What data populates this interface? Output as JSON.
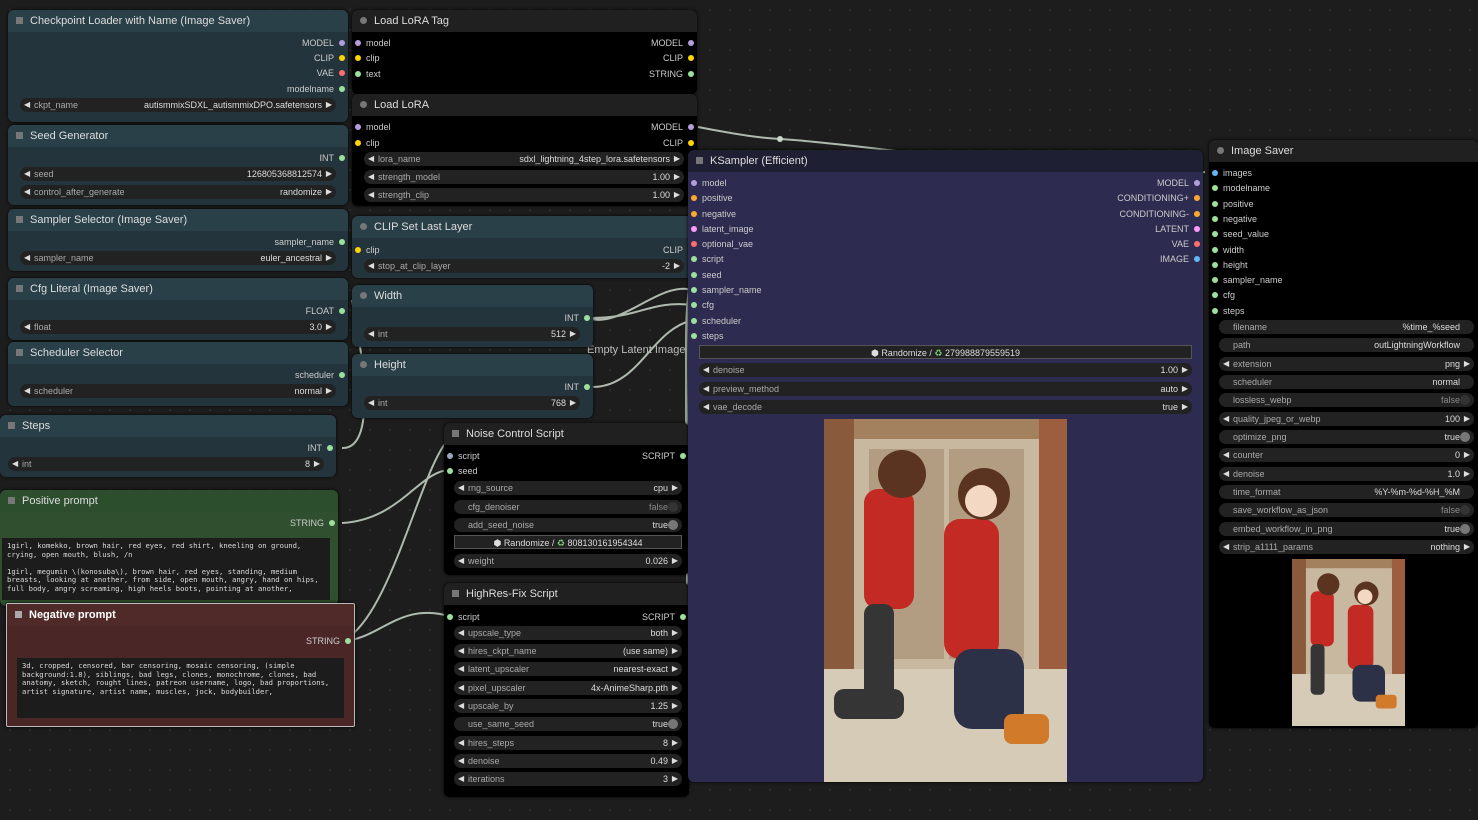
{
  "colors": {
    "model": "#b39ddb",
    "clip": "#ffd500",
    "vae": "#ff6e6e",
    "string": "#9de09d",
    "int": "#9de09d",
    "float": "#9de09d",
    "conditioning": "#ffa931",
    "latent": "#ff9cf9",
    "image": "#64b5f6",
    "script": "#9fa6bf"
  },
  "ckpt_loader": {
    "title": "Checkpoint Loader with Name (Image Saver)",
    "outputs": [
      "MODEL",
      "CLIP",
      "VAE",
      "modelname"
    ],
    "ckpt_label": "ckpt_name",
    "ckpt_value": "autismmixSDXL_autismmixDPO.safetensors"
  },
  "seed_gen": {
    "title": "Seed Generator",
    "output": "INT",
    "seed_label": "seed",
    "seed_value": "126805368812574",
    "cag_label": "control_after_generate",
    "cag_value": "randomize"
  },
  "sampler_sel": {
    "title": "Sampler Selector (Image Saver)",
    "output": "sampler_name",
    "label": "sampler_name",
    "value": "euler_ancestral"
  },
  "cfg_literal": {
    "title": "Cfg Literal (Image Saver)",
    "output": "FLOAT",
    "label": "float",
    "value": "3.0"
  },
  "sched_sel": {
    "title": "Scheduler Selector",
    "output": "scheduler",
    "label": "scheduler",
    "value": "normal"
  },
  "steps": {
    "title": "Steps",
    "output": "INT",
    "label": "int",
    "value": "8"
  },
  "pos_prompt": {
    "title": "Positive prompt",
    "output": "STRING",
    "text": "1girl, komekko, brown hair, red eyes, red shirt, kneeling on ground, crying, open mouth, blush, /n\n\n1girl, megumin \\(konosuba\\), brown hair, red eyes, standing, medium breasts, looking at another, from side, open mouth, angry, hand on hips, full body, angry screaming, high heels boots, pointing at another,"
  },
  "neg_prompt": {
    "title": "Negative prompt",
    "output": "STRING",
    "text": "3d, cropped, censored, bar censoring, mosaic censoring, (simple background:1.8), siblings, bad legs, clones, monochrome, clones, bad anatomy, sketch, rought lines, patreon username, logo, bad proportions, artist signature, artist name, muscles, jock, bodybuilder,"
  },
  "lora_tag": {
    "title": "Load LoRA Tag",
    "inputs": [
      "model",
      "clip",
      "text"
    ],
    "outputs": [
      "MODEL",
      "CLIP",
      "STRING"
    ]
  },
  "load_lora": {
    "title": "Load LoRA",
    "inputs": [
      "model",
      "clip"
    ],
    "outputs": [
      "MODEL",
      "CLIP"
    ],
    "w1_label": "lora_name",
    "w1_value": "sdxl_lightning_4step_lora.safetensors",
    "w2_label": "strength_model",
    "w2_value": "1.00",
    "w3_label": "strength_clip",
    "w3_value": "1.00"
  },
  "clip_last": {
    "title": "CLIP Set Last Layer",
    "input": "clip",
    "output": "CLIP",
    "label": "stop_at_clip_layer",
    "value": "-2"
  },
  "width": {
    "title": "Width",
    "output": "INT",
    "label": "int",
    "value": "512"
  },
  "height": {
    "title": "Height",
    "output": "INT",
    "label": "int",
    "value": "768"
  },
  "empty_latent": {
    "label": "Empty Latent Image"
  },
  "noise": {
    "title": "Noise Control Script",
    "inputs": [
      "script",
      "seed"
    ],
    "output": "SCRIPT",
    "rng_label": "rng_source",
    "rng_value": "cpu",
    "cfgd_label": "cfg_denoiser",
    "cfgd_value": "false",
    "asn_label": "add_seed_noise",
    "asn_value": "true",
    "rand_label": "Randomize /",
    "rand_seed": "808130161954344",
    "weight_label": "weight",
    "weight_value": "0.026"
  },
  "hires": {
    "title": "HighRes-Fix Script",
    "input": "script",
    "output": "SCRIPT",
    "rows": [
      {
        "label": "upscale_type",
        "value": "both"
      },
      {
        "label": "hires_ckpt_name",
        "value": "(use same)"
      },
      {
        "label": "latent_upscaler",
        "value": "nearest-exact"
      },
      {
        "label": "pixel_upscaler",
        "value": "4x-AnimeSharp.pth"
      },
      {
        "label": "upscale_by",
        "value": "1.25"
      },
      {
        "label": "use_same_seed",
        "value": "true"
      },
      {
        "label": "hires_steps",
        "value": "8"
      },
      {
        "label": "denoise",
        "value": "0.49"
      },
      {
        "label": "iterations",
        "value": "3"
      }
    ]
  },
  "ksampler": {
    "title": "KSampler (Efficient)",
    "inputs": [
      "model",
      "positive",
      "negative",
      "latent_image",
      "optional_vae",
      "script",
      "seed",
      "sampler_name",
      "cfg",
      "scheduler",
      "steps"
    ],
    "outputs": [
      "MODEL",
      "CONDITIONING+",
      "CONDITIONING-",
      "LATENT",
      "VAE",
      "IMAGE"
    ],
    "rand_label": "Randomize /",
    "rand_seed": "279988879559519",
    "rows": [
      {
        "label": "denoise",
        "value": "1.00"
      },
      {
        "label": "preview_method",
        "value": "auto"
      },
      {
        "label": "vae_decode",
        "value": "true"
      }
    ]
  },
  "saver": {
    "title": "Image Saver",
    "inputs": [
      "images",
      "modelname",
      "positive",
      "negative",
      "seed_value",
      "width",
      "height",
      "sampler_name",
      "cfg",
      "steps"
    ],
    "rows": [
      {
        "label": "filename",
        "value": "%time_%seed"
      },
      {
        "label": "path",
        "value": "outLightningWorkflow"
      },
      {
        "label": "extension",
        "value": "png"
      },
      {
        "label": "scheduler",
        "value": "normal"
      },
      {
        "label": "lossless_webp",
        "value": "false"
      },
      {
        "label": "quality_jpeg_or_webp",
        "value": "100"
      },
      {
        "label": "optimize_png",
        "value": "true"
      },
      {
        "label": "counter",
        "value": "0"
      },
      {
        "label": "denoise",
        "value": "1.0"
      },
      {
        "label": "time_format",
        "value": "%Y-%m-%d-%H_%M"
      },
      {
        "label": "save_workflow_as_json",
        "value": "false"
      },
      {
        "label": "embed_workflow_in_png",
        "value": "true"
      },
      {
        "label": "strip_a1111_params",
        "value": "nothing"
      }
    ]
  }
}
